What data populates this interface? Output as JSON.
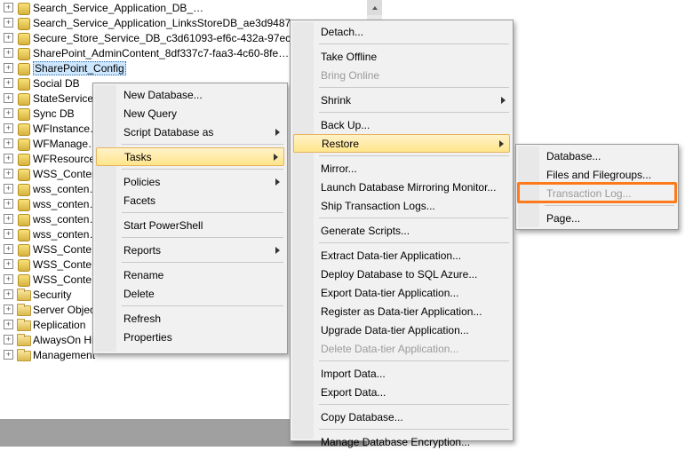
{
  "tree": {
    "databases": [
      "Search_Service_Application_DB_…",
      "Search_Service_Application_LinksStoreDB_ae3d9487…",
      "Secure_Store_Service_DB_c3d61093-ef6c-432a-97ec…",
      "SharePoint_AdminContent_8df337c7-faa3-4c60-8fe…",
      "SharePoint_Config",
      "Social DB",
      "StateService…",
      "Sync DB",
      "WFInstance…",
      "WFManage…",
      "WFResource…",
      "WSS_Conten…",
      "wss_conten…",
      "wss_conten…",
      "wss_conten…",
      "wss_conten…",
      "WSS_Conte…",
      "WSS_Conte…",
      "WSS_Conte…"
    ],
    "selected_index": 4,
    "folders": [
      "Security",
      "Server Objects",
      "Replication",
      "AlwaysOn High Availability",
      "Management"
    ]
  },
  "menu1": {
    "items": [
      {
        "label": "New Database...",
        "sub": false
      },
      {
        "label": "New Query",
        "sub": false
      },
      {
        "label": "Script Database as",
        "sub": true
      },
      {
        "sep": true
      },
      {
        "label": "Tasks",
        "sub": true,
        "highlight": true
      },
      {
        "sep": true
      },
      {
        "label": "Policies",
        "sub": true
      },
      {
        "label": "Facets",
        "sub": false
      },
      {
        "sep": true
      },
      {
        "label": "Start PowerShell",
        "sub": false
      },
      {
        "sep": true
      },
      {
        "label": "Reports",
        "sub": true
      },
      {
        "sep": true
      },
      {
        "label": "Rename",
        "sub": false
      },
      {
        "label": "Delete",
        "sub": false
      },
      {
        "sep": true
      },
      {
        "label": "Refresh",
        "sub": false
      },
      {
        "label": "Properties",
        "sub": false
      }
    ]
  },
  "menu2": {
    "items": [
      {
        "label": "Detach...",
        "sub": false
      },
      {
        "sep": true
      },
      {
        "label": "Take Offline",
        "sub": false
      },
      {
        "label": "Bring Online",
        "sub": false,
        "disabled": true
      },
      {
        "sep": true
      },
      {
        "label": "Shrink",
        "sub": true
      },
      {
        "sep": true
      },
      {
        "label": "Back Up...",
        "sub": false
      },
      {
        "label": "Restore",
        "sub": true,
        "highlight": true
      },
      {
        "sep": true
      },
      {
        "label": "Mirror...",
        "sub": false
      },
      {
        "label": "Launch Database Mirroring Monitor...",
        "sub": false
      },
      {
        "label": "Ship Transaction Logs...",
        "sub": false
      },
      {
        "sep": true
      },
      {
        "label": "Generate Scripts...",
        "sub": false
      },
      {
        "sep": true
      },
      {
        "label": "Extract Data-tier Application...",
        "sub": false
      },
      {
        "label": "Deploy Database to SQL Azure...",
        "sub": false
      },
      {
        "label": "Export Data-tier Application...",
        "sub": false
      },
      {
        "label": "Register as Data-tier Application...",
        "sub": false
      },
      {
        "label": "Upgrade Data-tier Application...",
        "sub": false
      },
      {
        "label": "Delete Data-tier Application...",
        "sub": false,
        "disabled": true
      },
      {
        "sep": true
      },
      {
        "label": "Import Data...",
        "sub": false
      },
      {
        "label": "Export Data...",
        "sub": false
      },
      {
        "sep": true
      },
      {
        "label": "Copy Database...",
        "sub": false
      },
      {
        "sep": true
      },
      {
        "label": "Manage Database Encryption...",
        "sub": false
      }
    ]
  },
  "menu3": {
    "items": [
      {
        "label": "Database...",
        "sub": false
      },
      {
        "label": "Files and Filegroups...",
        "sub": false
      },
      {
        "label": "Transaction Log...",
        "sub": false,
        "disabled": true,
        "boxed": true
      },
      {
        "sep": true
      },
      {
        "label": "Page...",
        "sub": false
      }
    ]
  }
}
